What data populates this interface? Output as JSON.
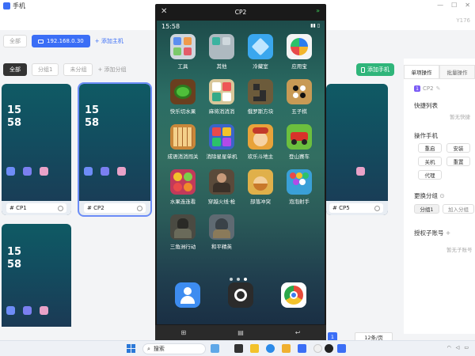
{
  "app": {
    "title": "手机",
    "window_controls": [
      "—",
      "☐",
      "✕"
    ],
    "right_mark": "Y176"
  },
  "host_bar": {
    "all": "全部",
    "host_ip": "192.168.0.30",
    "add_host": "+ 添加主机"
  },
  "group_bar": {
    "all": "全部",
    "group1": "分组1",
    "ungrouped": "未分组",
    "add_group": "+ 添加分组",
    "add_phone": "添加手机"
  },
  "cards": [
    {
      "time_h": "15",
      "time_m": "58",
      "label": "# CP1"
    },
    {
      "time_h": "15",
      "time_m": "58",
      "label": "# CP2"
    },
    {
      "time_h": "15",
      "time_m": "58",
      "label": "# CP5"
    },
    {
      "time_h": "15",
      "time_m": "58",
      "label": ""
    }
  ],
  "right_panel": {
    "tab_single": "单项操作",
    "tab_batch": "批量操作",
    "badge": "1",
    "device": "CP2",
    "shortcut_list": "快捷列表",
    "no_shortcut": "暂无快捷",
    "operate_phone": "操作手机",
    "ops": [
      "重启",
      "安装",
      "关机",
      "重置",
      "代理"
    ],
    "change_group": "更换分组",
    "group_current": "分组1",
    "join_group": "加入分组",
    "auth_account": "授权子账号",
    "auth_plus": "+",
    "no_sub_account": "暂无子账号"
  },
  "pager": {
    "page": "1",
    "per_page": "12条/页"
  },
  "phone": {
    "title": "CP2",
    "close": "✕",
    "expand": "»",
    "time": "15:58",
    "apps": [
      {
        "name": "工具",
        "color": "#cfd6dd"
      },
      {
        "name": "其他",
        "color": "#aeb9c0"
      },
      {
        "name": "冷藏室",
        "color": "#3aa7ee"
      },
      {
        "name": "应用宝",
        "color": "#f4f4f4"
      },
      {
        "name": "快乐切水果",
        "color": "#6a3f1f"
      },
      {
        "name": "麻将消消消",
        "color": "#d9c79a"
      },
      {
        "name": "俄罗斯方块",
        "color": "#6c5b3b"
      },
      {
        "name": "五子棋",
        "color": "#c89a55"
      },
      {
        "name": "成语消消闯关",
        "color": "#c8873a"
      },
      {
        "name": "消除星星单机",
        "color": "#3a64c9"
      },
      {
        "name": "欢乐斗地主",
        "color": "#e8a33a"
      },
      {
        "name": "登山赛车",
        "color": "#6cbf3e"
      },
      {
        "name": "水果连连看",
        "color": "#c23a5a"
      },
      {
        "name": "穿越火线·枪",
        "color": "#5a4a3a"
      },
      {
        "name": "部落冲突",
        "color": "#e0b04a"
      },
      {
        "name": "泡泡射手",
        "color": "#3aa0d8"
      },
      {
        "name": "三角洲行动",
        "color": "#4a4a42"
      },
      {
        "name": "和平精英",
        "color": "#5f6a72"
      }
    ],
    "nav": [
      "⊞",
      "▤",
      "↩"
    ]
  },
  "taskbar": {
    "search": "搜索"
  }
}
